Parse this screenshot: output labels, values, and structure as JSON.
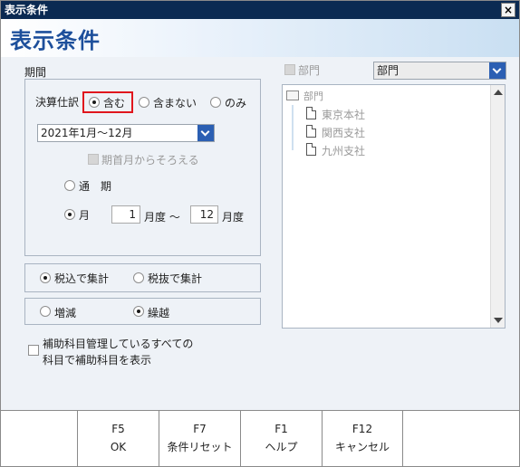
{
  "window": {
    "title": "表示条件",
    "close_glyph": "×"
  },
  "header": {
    "title": "表示条件"
  },
  "period": {
    "group_label": "期間",
    "settlement_label": "決算仕訳",
    "settlement_options": [
      "含む",
      "含まない",
      "のみ"
    ],
    "settlement_selected": "含む",
    "period_combo_value": "2021年1月～12月",
    "align_start_label": "期首月からそろえる",
    "mode_full_label": "通　期",
    "mode_month_label": "月",
    "mode_selected": "月",
    "month_from": "1",
    "month_from_unit": "月度 ～",
    "month_to": "12",
    "month_to_unit": "月度"
  },
  "tax": {
    "options": [
      "税込で集計",
      "税抜で集計"
    ],
    "selected": "税込で集計"
  },
  "change": {
    "options": [
      "増減",
      "繰越"
    ],
    "selected": "繰越"
  },
  "subaccount": {
    "label_line1": "補助科目管理しているすべての",
    "label_line2": "科目で補助科目を表示"
  },
  "department": {
    "checkbox_label": "部門",
    "combo_value": "部門",
    "tree_root": "部門",
    "tree_items": [
      "東京本社",
      "関西支社",
      "九州支社"
    ]
  },
  "buttons": [
    {
      "key": "F5",
      "label": "OK"
    },
    {
      "key": "F7",
      "label": "条件リセット"
    },
    {
      "key": "F1",
      "label": "ヘルプ"
    },
    {
      "key": "F12",
      "label": "キャンセル"
    }
  ],
  "colors": {
    "title_bar": "#0b2a52",
    "header_text": "#1d4f9b",
    "highlight": "#e0161d",
    "combo_button": "#2b5fb3"
  }
}
